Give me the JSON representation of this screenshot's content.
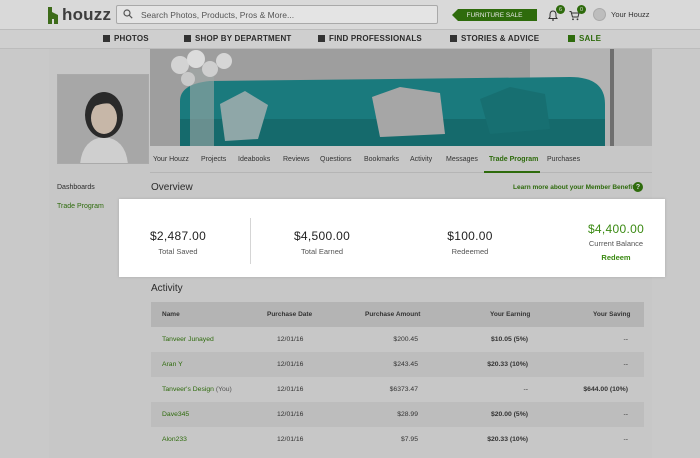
{
  "header": {
    "logo_text": "houzz",
    "search_placeholder": "Search Photos, Products, Pros & More...",
    "sale_pill": "FURNITURE SALE",
    "notifications_count": "6",
    "cart_count": "0",
    "account_label": "Your Houzz"
  },
  "nav": {
    "items": [
      {
        "label": "PHOTOS",
        "icon": "camera-icon"
      },
      {
        "label": "SHOP BY DEPARTMENT",
        "icon": "cart-icon"
      },
      {
        "label": "FIND PROFESSIONALS",
        "icon": "person-icon"
      },
      {
        "label": "STORIES & ADVICE",
        "icon": "book-icon"
      },
      {
        "label": "SALE",
        "icon": "gift-icon"
      }
    ]
  },
  "profile_tabs": [
    "Your Houzz",
    "Projects",
    "Ideabooks",
    "Reviews",
    "Questions",
    "Bookmarks",
    "Activity",
    "Messages",
    "Trade Program",
    "Purchases"
  ],
  "active_tab": "Trade Program",
  "sidebar": {
    "items": [
      {
        "label": "Dashboards"
      },
      {
        "label": "Trade Program"
      }
    ]
  },
  "overview": {
    "title": "Overview",
    "learn_more": "Learn more about your Member Benefits",
    "stats": [
      {
        "value": "$2,487.00",
        "label": "Total Saved"
      },
      {
        "value": "$4,500.00",
        "label": "Total Earned"
      },
      {
        "value": "$100.00",
        "label": "Redeemed"
      },
      {
        "value": "$4,400.00",
        "label": "Current Balance"
      }
    ],
    "redeem_label": "Redeem"
  },
  "activity": {
    "title": "Activity",
    "columns": [
      "Name",
      "Purchase Date",
      "Purchase Amount",
      "Your Earning",
      "Your Saving"
    ],
    "rows": [
      {
        "name": "Tanveer Junayed",
        "suffix": "",
        "date": "12/01/16",
        "amount": "$200.45",
        "earning": "$10.05 (5%)",
        "saving": "--"
      },
      {
        "name": "Aran Y",
        "suffix": "",
        "date": "12/01/16",
        "amount": "$243.45",
        "earning": "$20.33 (10%)",
        "saving": "--"
      },
      {
        "name": "Tanveer's Design",
        "suffix": "(You)",
        "date": "12/01/16",
        "amount": "$6373.47",
        "earning": "--",
        "saving": "$644.00 (10%)"
      },
      {
        "name": "Dave345",
        "suffix": "",
        "date": "12/01/16",
        "amount": "$28.99",
        "earning": "$20.00 (5%)",
        "saving": "--"
      },
      {
        "name": "Alon233",
        "suffix": "",
        "date": "12/01/16",
        "amount": "$7.95",
        "earning": "$20.33 (10%)",
        "saving": "--"
      }
    ]
  }
}
